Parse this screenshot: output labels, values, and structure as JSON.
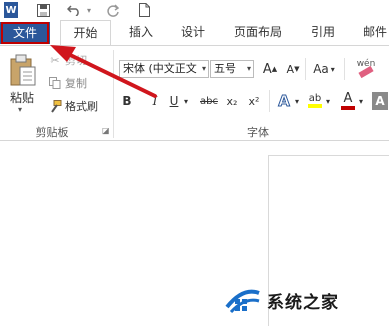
{
  "qat": {
    "word_icon": "W",
    "icons": [
      "word-app-icon",
      "save-icon",
      "undo-icon",
      "redo-icon",
      "new-document-icon"
    ]
  },
  "tabs": {
    "file": "文件",
    "items": [
      "开始",
      "插入",
      "设计",
      "页面布局",
      "引用",
      "邮件"
    ]
  },
  "clipboard": {
    "paste_label": "粘贴",
    "cut_label": "剪切",
    "copy_label": "复制",
    "format_painter_label": "格式刷",
    "group_label": "剪贴板"
  },
  "font": {
    "font_name": "宋体 (中文正文",
    "font_size": "五号",
    "grow": "A",
    "shrink": "A",
    "change_case": "Aa",
    "clear_format": "wén",
    "bold": "B",
    "italic": "I",
    "underline": "U",
    "strike": "abc",
    "subscript": "x₂",
    "superscript": "x²",
    "text_effect": "A",
    "highlight": "ab",
    "font_color": "A",
    "shading": "A",
    "group_label": "字体"
  },
  "watermark": {
    "text": "系统之家"
  },
  "colors": {
    "file_tab": "#2b579a",
    "highlight_box": "#c00000",
    "arrow": "#d0161d",
    "font_color_bar": "#c00000",
    "highlight_bar": "#ffff00"
  }
}
